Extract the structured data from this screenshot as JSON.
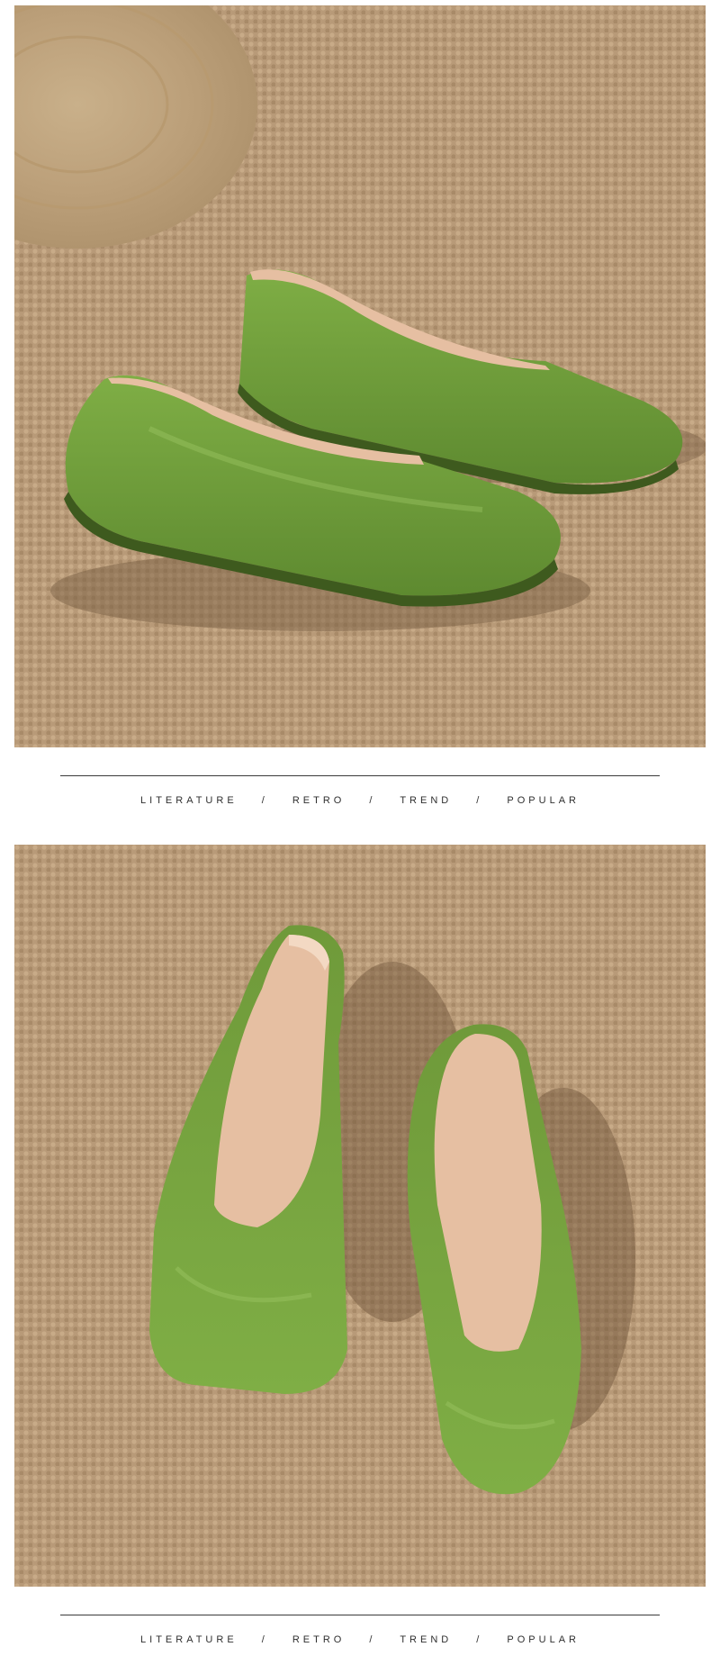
{
  "taglines": [
    {
      "words": [
        "LITERATURE",
        "RETRO",
        "TREND",
        "POPULAR"
      ],
      "separator": "/"
    },
    {
      "words": [
        "LITERATURE",
        "RETRO",
        "TREND",
        "POPULAR"
      ],
      "separator": "/"
    }
  ],
  "photos": [
    {
      "subject": "green leather flat shoes side view on woven mat",
      "icon": "product-photo"
    },
    {
      "subject": "green leather flat shoes top view on woven mat",
      "icon": "product-photo"
    }
  ],
  "colors": {
    "leather_green": "#6f9a3a",
    "leather_dark": "#4f7428",
    "lining": "#e6bfa2",
    "mat": "#b89a78",
    "mat_dark": "#9c7e5e",
    "divider": "#3a3a3a",
    "text": "#2e2e2e"
  }
}
